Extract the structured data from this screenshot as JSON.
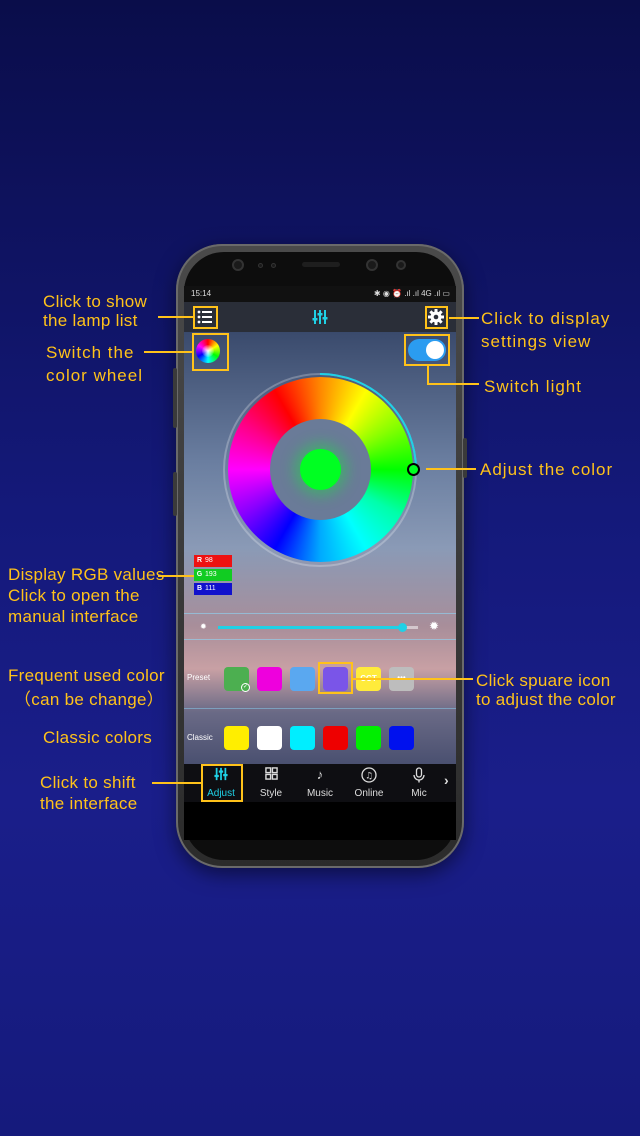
{
  "annotations": {
    "lamp_list": [
      "Click to show",
      "the lamp  list"
    ],
    "settings": [
      "Click to display",
      "settings view"
    ],
    "color_wheel": [
      "Switch the",
      "color wheel"
    ],
    "switch_light": "Switch light",
    "adjust_color": "Adjust the color",
    "rgb": [
      "Display RGB values",
      "Click to open the",
      "manual interface"
    ],
    "frequent": [
      "Frequent used color",
      "（can be change）"
    ],
    "classic": "Classic colors",
    "square_icon": [
      "Click  spuare  icon",
      "to adjust the color"
    ],
    "shift": [
      "Click to shift",
      "the interface"
    ]
  },
  "status_bar": {
    "time": "15:14",
    "icons": "✱ ◉ ⏰ .ıl .ıl 4G .ıl ▭"
  },
  "app_bar": {
    "list_icon": "list-icon",
    "center_icon": "equalizer-icon",
    "settings_icon": "gear-icon"
  },
  "rgb_values": {
    "r_label": "R",
    "r": "98",
    "g_label": "G",
    "g": "193",
    "b_label": "B",
    "b": "111"
  },
  "current_color": "#00ff22",
  "toggle_on": true,
  "brightness_level": 0.92,
  "preset": {
    "label": "Preset",
    "colors": [
      "#4caf50",
      "#ee00dd",
      "#5aa8f0",
      "#7a55e8",
      "#ffeb3b",
      "#bdbdbd"
    ],
    "cct_label": "CCT",
    "dots_label": "•••"
  },
  "classic": {
    "label": "Classic",
    "colors": [
      "#ffee00",
      "#ffffff",
      "#00eeff",
      "#ee0000",
      "#00ee00",
      "#0011ee"
    ]
  },
  "tabs": [
    {
      "label": "Adjust",
      "icon": "sliders-icon",
      "active": true
    },
    {
      "label": "Style",
      "icon": "grid-icon"
    },
    {
      "label": "Music",
      "icon": "music-note-icon"
    },
    {
      "label": "Online",
      "icon": "online-music-icon"
    },
    {
      "label": "Mic",
      "icon": "microphone-icon"
    }
  ],
  "more_icon": "chevron-right-icon",
  "colors": {
    "annotation": "#ffc21a",
    "accent": "#1fd1e6",
    "toggle_on": "#2b9cf0"
  }
}
